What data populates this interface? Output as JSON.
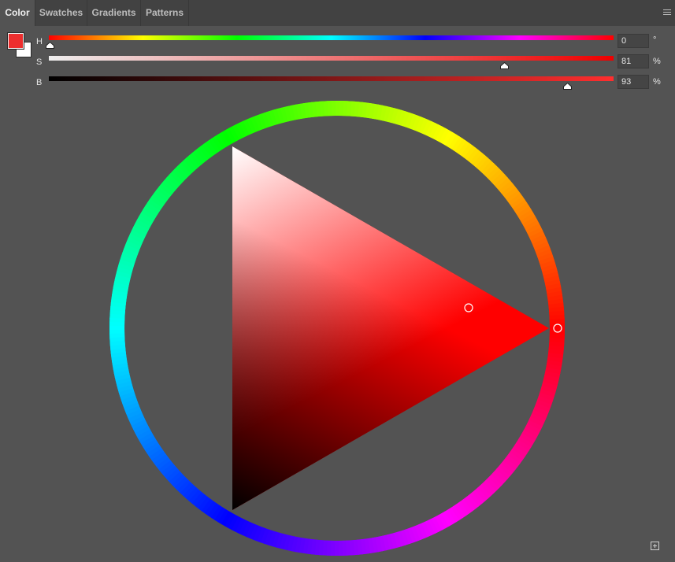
{
  "tabs": [
    {
      "label": "Color",
      "active": true
    },
    {
      "label": "Swatches",
      "active": false
    },
    {
      "label": "Gradients",
      "active": false
    },
    {
      "label": "Patterns",
      "active": false
    }
  ],
  "colors": {
    "foreground": "#ed2e2e",
    "background": "#ffffff",
    "panel": "#535353"
  },
  "sliders": {
    "h": {
      "label": "H",
      "value": "0",
      "unit": "°"
    },
    "s": {
      "label": "S",
      "value": "81",
      "unit": "%"
    },
    "b": {
      "label": "B",
      "value": "93",
      "unit": "%"
    }
  },
  "hsb": {
    "hue": 0,
    "saturation": 81,
    "brightness": 93
  }
}
